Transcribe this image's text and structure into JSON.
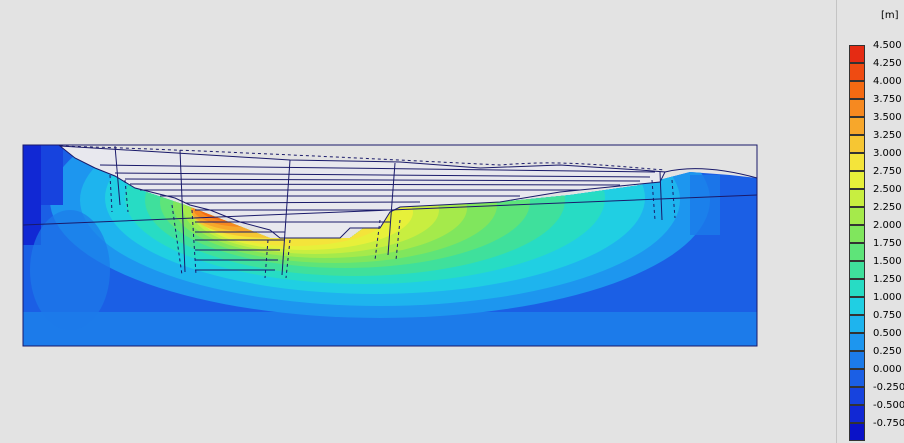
{
  "legend": {
    "unit": "[m]",
    "entries": [
      {
        "label": "4.500",
        "color": "#e52b13"
      },
      {
        "label": "4.250",
        "color": "#ef4b12"
      },
      {
        "label": "4.000",
        "color": "#f56a12"
      },
      {
        "label": "3.750",
        "color": "#f68920"
      },
      {
        "label": "3.500",
        "color": "#f7a72b"
      },
      {
        "label": "3.250",
        "color": "#f6c633"
      },
      {
        "label": "3.000",
        "color": "#f4e43a"
      },
      {
        "label": "2.750",
        "color": "#e7f03a"
      },
      {
        "label": "2.500",
        "color": "#c8ee40"
      },
      {
        "label": "2.250",
        "color": "#a5ea4b"
      },
      {
        "label": "2.000",
        "color": "#80e65d"
      },
      {
        "label": "1.750",
        "color": "#5ee479"
      },
      {
        "label": "1.500",
        "color": "#3fe09c"
      },
      {
        "label": "1.250",
        "color": "#27dcc4"
      },
      {
        "label": "1.000",
        "color": "#20cfe3"
      },
      {
        "label": "0.750",
        "color": "#1eb4ee"
      },
      {
        "label": "0.500",
        "color": "#1d96ef"
      },
      {
        "label": "0.250",
        "color": "#1c7bea"
      },
      {
        "label": "0.000",
        "color": "#1b5fe5"
      },
      {
        "label": "-0.250",
        "color": "#1743de"
      },
      {
        "label": "-0.500",
        "color": "#1128d4"
      },
      {
        "label": "-0.750",
        "color": "#0a12c8"
      }
    ]
  }
}
